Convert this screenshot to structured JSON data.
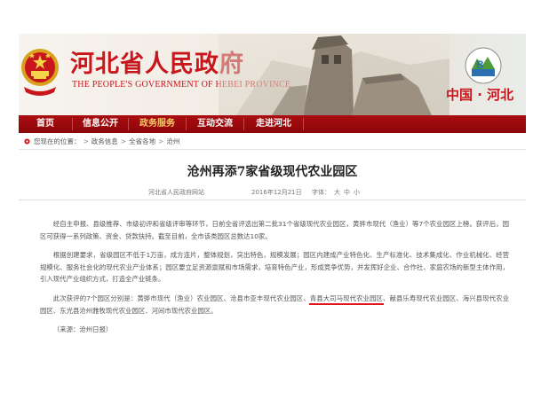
{
  "header": {
    "title": "河北省人民政府",
    "subtitle": "THE PEOPLE'S GOVERNMENT OF HEBEI PROVINCE",
    "region_label": "中国 · 河北",
    "brand_color": "#c8161d",
    "emblem_icon": "national-emblem-icon",
    "badge_icon": "hebei-logo-icon"
  },
  "nav": {
    "bg_color": "#a90e12",
    "active_color": "#f7c96b",
    "items": [
      {
        "label": "首页"
      },
      {
        "label": "信息公开"
      },
      {
        "label": "政务服务"
      },
      {
        "label": "互动交流"
      },
      {
        "label": "走进河北"
      }
    ],
    "active": "政务服务"
  },
  "breadcrumb": {
    "prefix": "您现在的位置：",
    "items": [
      "政务信息",
      "全省各地",
      "沧州"
    ]
  },
  "article": {
    "title": "沧州再添7家省级现代农业园区",
    "source": "河北省人民政府网站",
    "date": "2016年12月21日",
    "font_label": "字体：",
    "font_sizes": [
      "大",
      "中",
      "小"
    ],
    "p1": "经自主申报、县级推荐、市级初评和省级评审等环节，日前全省评选出第二批31个省级现代农业园区，黄骅市现代（渔业）等7个农业园区上榜。获评后，园区可获得一系列政策、资金、贷款扶持。截至目前，全市该类园区总数达10家。",
    "p2": "根据创建要求，省级园区不低于1万亩，成方连片，整体规划，突出特色，规模发展；园区内建成产业特色化、生产标准化、技术集成化、作业机械化、经营规模化、服务社会化的现代农业产业体系；园区要立足资源禀赋和市场需求，培育特色产业，形成竞争优势，并发挥好企业、合作社、家庭农场的新型主体作用，引入现代产业组织方式，打造全产业链条。",
    "p3_a": "此次获评的7个园区分别是：黄骅市现代（渔业）农业园区、沧县市亚丰现代农业园区、",
    "p3_highlight": "青县大司马现代农业园区",
    "p3_b": "、献县乐寿现代农业园区、海兴县现代农业园区、东光县沧州雅牧现代农业园区、河间市现代农业园区。",
    "p4": "（来源：沧州日报）",
    "highlight_color": "#e1151c"
  }
}
